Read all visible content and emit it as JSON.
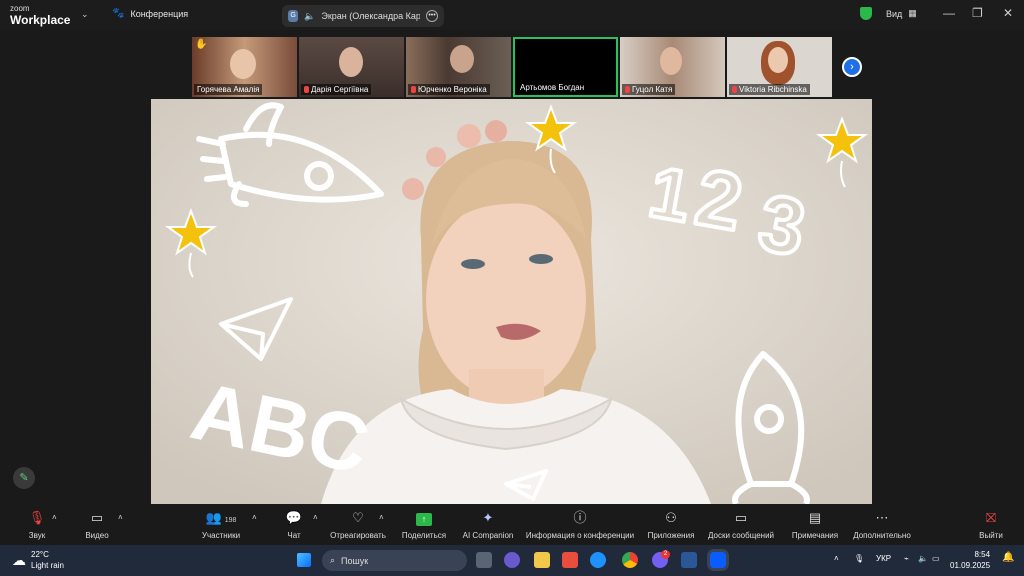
{
  "app": {
    "brand_top": "zoom",
    "brand_bottom": "Workplace",
    "conference_tab": "Конференция",
    "screen_tab": "Экран (Олександра Кардаш",
    "screen_badge": "G",
    "view_label": "Вид"
  },
  "participants": [
    {
      "name": "Горячева Амалія",
      "muted": false,
      "bg": "#8a5a40"
    },
    {
      "name": "Дарія Сергіївна",
      "muted": true,
      "bg": "#5c4a44"
    },
    {
      "name": "Юрченко Вероніка",
      "muted": true,
      "bg": "#6b5f55"
    },
    {
      "name": "Артьомов Богдан",
      "muted": false,
      "bg": "#000000",
      "active": true
    },
    {
      "name": "Гуцол Катя",
      "muted": true,
      "bg": "#8a6e5e"
    },
    {
      "name": "Viktoria Ribchinska",
      "muted": true,
      "bg": "#d8d2cc"
    }
  ],
  "stage": {
    "doodle_text_abc": "ABC",
    "doodle_digits": [
      "1",
      "2",
      "3"
    ]
  },
  "toolbar": {
    "audio": "Звук",
    "video": "Видео",
    "participants": "Участники",
    "participants_count": "198",
    "chat": "Чат",
    "react": "Отреагировать",
    "share": "Поделиться",
    "ai": "AI Companion",
    "info": "Информация о конференции",
    "apps": "Приложения",
    "whiteboards": "Доски сообщений",
    "notes": "Примечания",
    "more": "Дополнительно",
    "leave": "Выйти"
  },
  "taskbar": {
    "temp": "22°C",
    "weather": "Light rain",
    "search_placeholder": "Пошук",
    "lang": "УКР",
    "time": "8:54",
    "date": "01.09.2025",
    "badge_count": "2"
  },
  "colors": {
    "accent_blue": "#1e6fe8",
    "share_green": "#2db84b",
    "active_border": "#2fbf5e",
    "star": "#f4c20d"
  }
}
